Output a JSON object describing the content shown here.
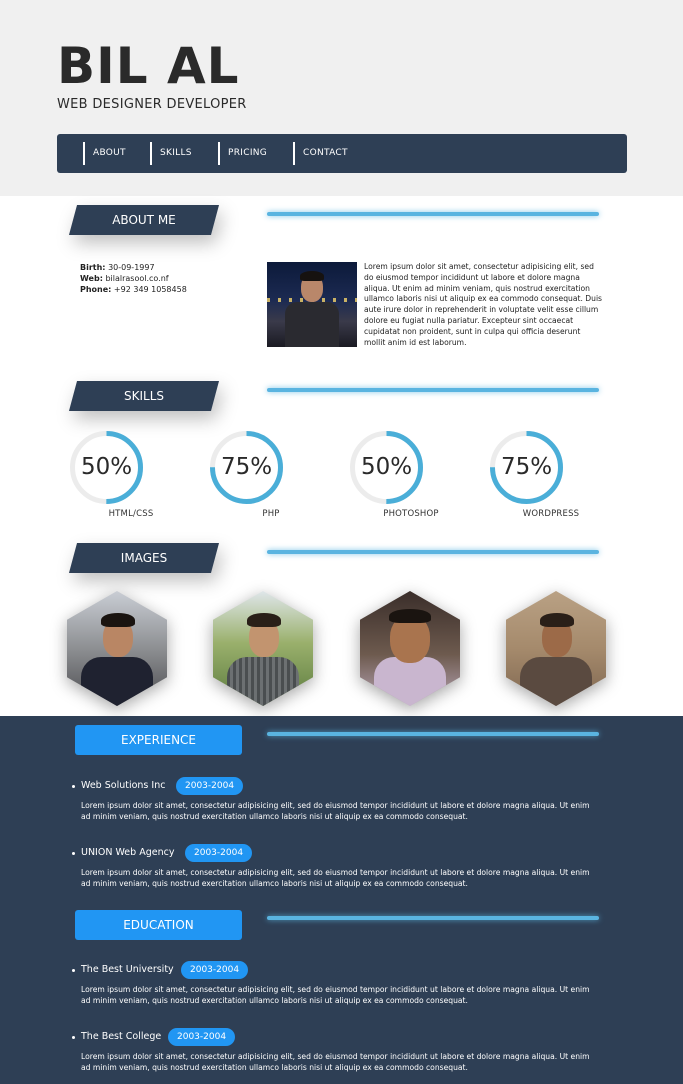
{
  "header": {
    "name": "BIL AL",
    "subtitle": "WEB DESIGNER DEVELOPER"
  },
  "nav": {
    "items": [
      {
        "label": "ABOUT"
      },
      {
        "label": "SKILLS"
      },
      {
        "label": "PRICING"
      },
      {
        "label": "CONTACT"
      }
    ]
  },
  "sections": {
    "about_title": "ABOUT ME",
    "skills_title": "SKILLS",
    "images_title": "IMAGES",
    "experience_title": "EXPERIENCE",
    "education_title": "EDUCATION"
  },
  "about": {
    "birth_label": "Birth:",
    "birth_value": "30-09-1997",
    "web_label": "Web:",
    "web_value": "bilalrasool.co.nf",
    "phone_label": "Phone:",
    "phone_value": "+92 349 1058458",
    "bio": "Lorem ipsum dolor sit amet, consectetur adipisicing elit, sed do eiusmod tempor incididunt ut labore et dolore magna aliqua. Ut enim ad minim veniam, quis nostrud exercitation ullamco laboris nisi ut aliquip ex ea commodo consequat. Duis aute irure dolor in reprehenderit in voluptate velit esse cillum dolore eu fugiat nulla pariatur. Excepteur sint occaecat cupidatat non proident, sunt in culpa qui officia deserunt mollit anim id est laborum."
  },
  "skills": [
    {
      "label": "HTML/CSS",
      "percent_text": "50%",
      "value": 0.5
    },
    {
      "label": "PHP",
      "percent_text": "75%",
      "value": 0.75
    },
    {
      "label": "PHOTOSHOP",
      "percent_text": "50%",
      "value": 0.5
    },
    {
      "label": "WORDPRESS",
      "percent_text": "75%",
      "value": 0.75
    }
  ],
  "experience": [
    {
      "title": "Web Solutions Inc",
      "years": "2003-2004",
      "text": "Lorem ipsum dolor sit amet, consectetur adipisicing elit, sed do eiusmod tempor incididunt ut labore et dolore magna aliqua. Ut enim ad minim veniam, quis nostrud exercitation ullamco laboris nisi ut aliquip ex ea commodo consequat."
    },
    {
      "title": "UNION Web Agency",
      "years": "2003-2004",
      "text": "Lorem ipsum dolor sit amet, consectetur adipisicing elit, sed do eiusmod tempor incididunt ut labore et dolore magna aliqua. Ut enim ad minim veniam, quis nostrud exercitation ullamco laboris nisi ut aliquip ex ea commodo consequat."
    }
  ],
  "education": [
    {
      "title": "The Best University",
      "years": "2003-2004",
      "text": "Lorem ipsum dolor sit amet, consectetur adipisicing elit, sed do eiusmod tempor incididunt ut labore et dolore magna aliqua. Ut enim ad minim veniam, quis nostrud exercitation ullamco laboris nisi ut aliquip ex ea commodo consequat."
    },
    {
      "title": "The Best College",
      "years": "2003-2004",
      "text": "Lorem ipsum dolor sit amet, consectetur adipisicing elit, sed do eiusmod tempor incididunt ut labore et dolore magna aliqua. Ut enim ad minim veniam, quis nostrud exercitation ullamco laboris nisi ut aliquip ex ea commodo consequat."
    }
  ],
  "colors": {
    "dark_navy": "#2e3f55",
    "accent_blue": "#2196f3",
    "ring_blue": "#4aaed8",
    "ring_track": "#ececec"
  }
}
